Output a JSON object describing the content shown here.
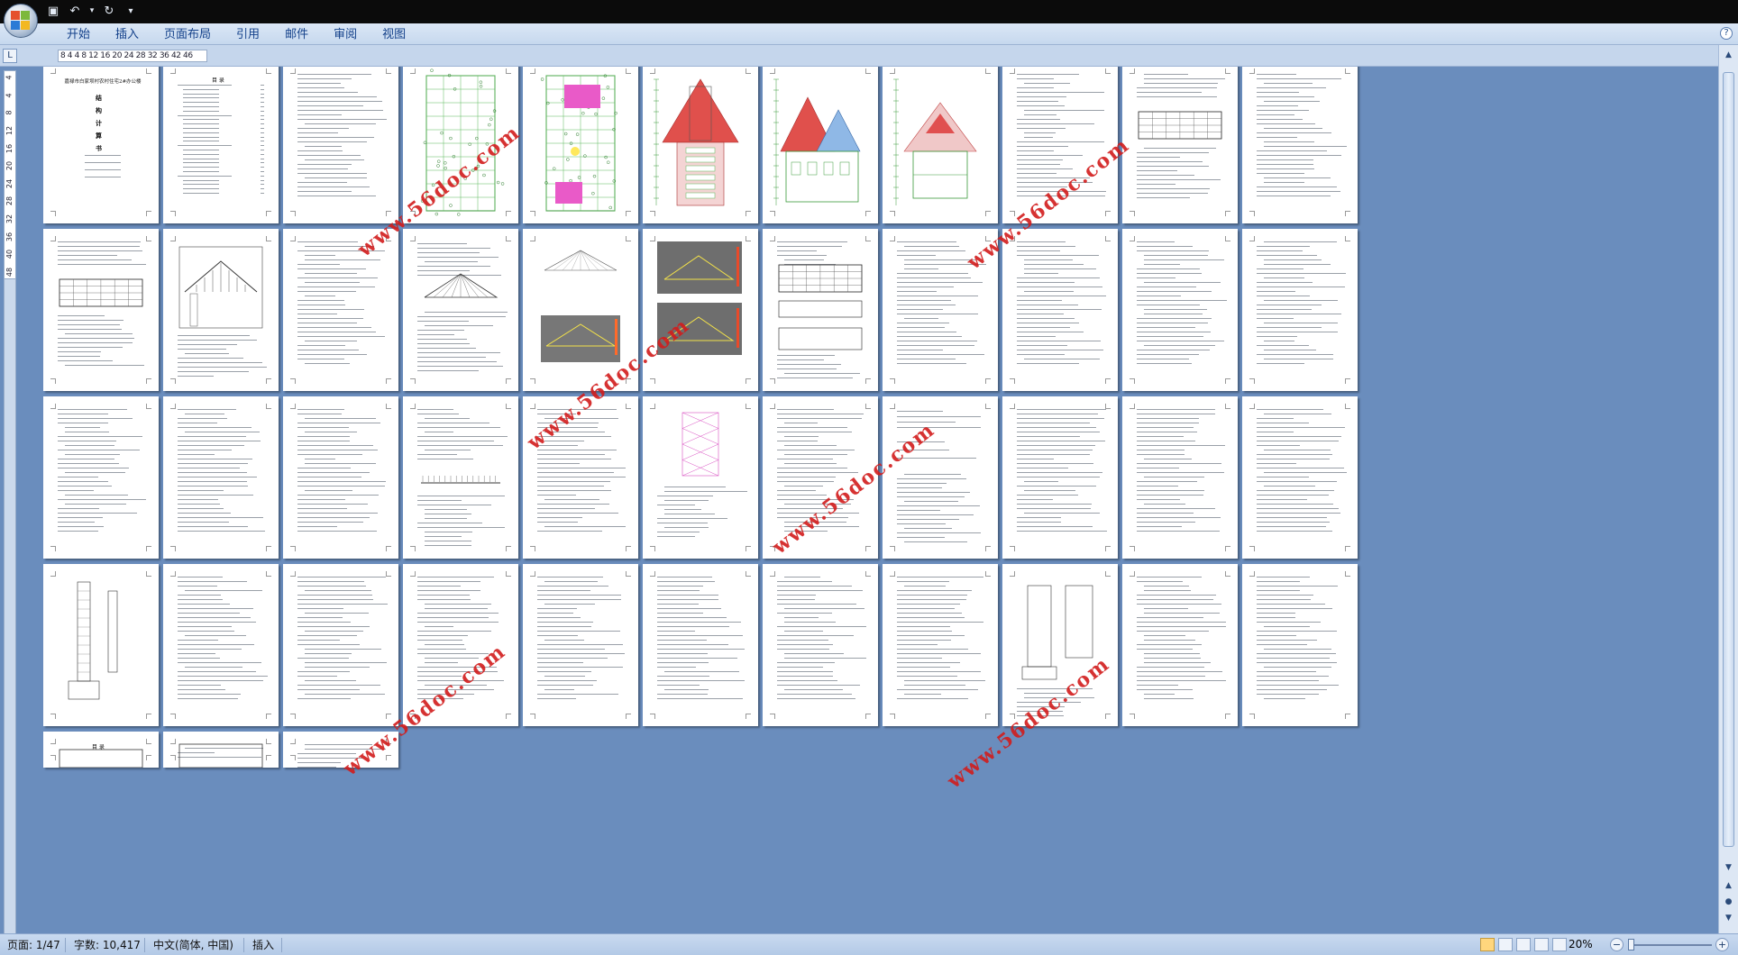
{
  "window": {
    "accent": "#15428b",
    "desktop_color": "#6a8dbd"
  },
  "quick_access": [
    {
      "name": "save-icon",
      "glyph": "💾"
    },
    {
      "name": "undo-icon",
      "glyph": "↶"
    },
    {
      "name": "redo-icon",
      "glyph": "↻"
    },
    {
      "name": "customize-icon",
      "glyph": "▾"
    }
  ],
  "ribbon": {
    "tabs": [
      "开始",
      "插入",
      "页面布局",
      "引用",
      "邮件",
      "审阅",
      "视图"
    ],
    "help": "?"
  },
  "ruler": {
    "horizontal": "8 4 4 8 12 16 20 24 28 32 36 42 46",
    "vertical": [
      "4",
      "4",
      "8",
      "12",
      "16",
      "20",
      "24",
      "28",
      "32",
      "36",
      "40",
      "48"
    ],
    "corner": "L"
  },
  "document": {
    "watermark": "www.56doc.com",
    "cover_title": "嘉禄市白家坝村农村住宅2#办公楼",
    "cover_lines": [
      "结",
      "构",
      "计",
      "算",
      "书"
    ],
    "toc_title": "目 录"
  },
  "status": {
    "page": "页面: 1/47",
    "words": "字数: 10,417",
    "language": "中文(简体, 中国)",
    "mode": "插入",
    "zoom": "20%"
  }
}
